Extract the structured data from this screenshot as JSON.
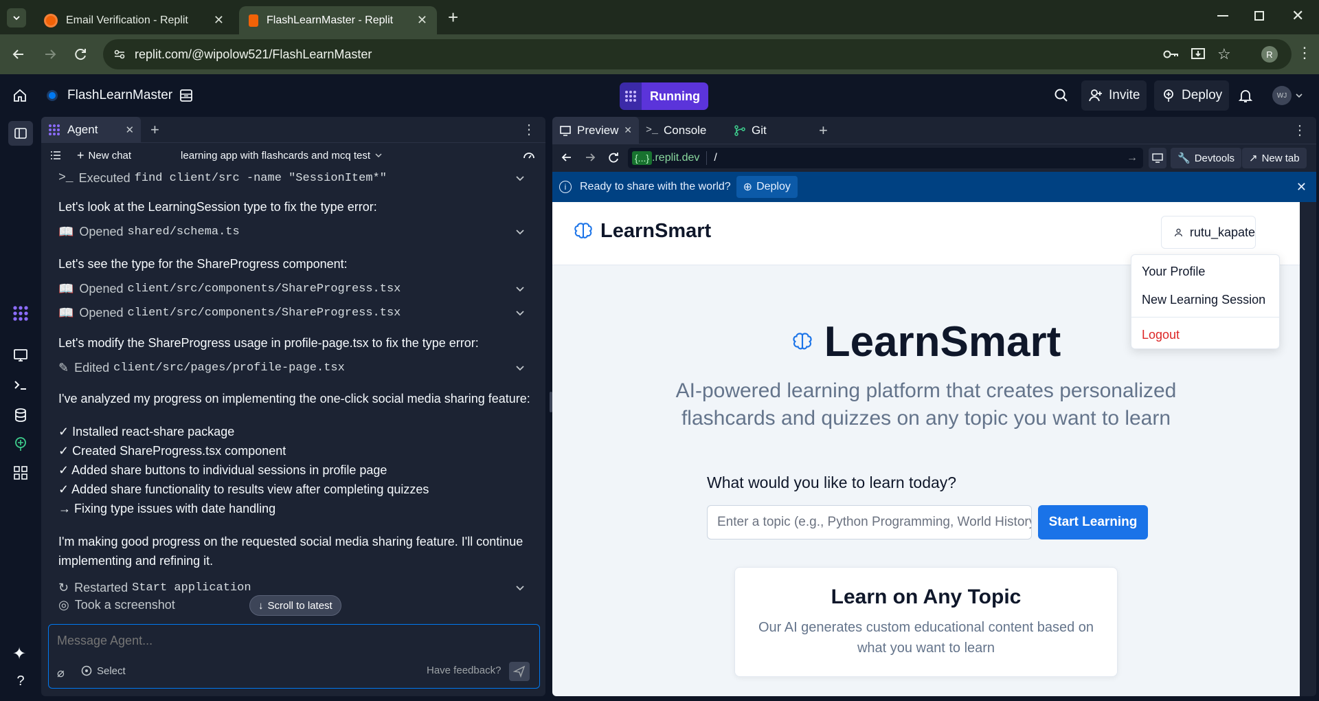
{
  "browser": {
    "tabs": [
      {
        "title": "Email Verification - Replit"
      },
      {
        "title": "FlashLearnMaster - Replit"
      }
    ],
    "url": "replit.com/@wipolow521/FlashLearnMaster",
    "profile_initial": "R"
  },
  "topbar": {
    "project_name": "FlashLearnMaster",
    "run_status": "Running",
    "invite_label": "Invite",
    "deploy_label": "Deploy",
    "avatar_initials": "WJ"
  },
  "agent": {
    "tab_label": "Agent",
    "new_chat_label": "New chat",
    "chat_title": "learning app with flashcards and mcq test",
    "messages": [
      {
        "kind": "action",
        "verb": "Executed",
        "code": "find client/src -name \"SessionItem*\""
      },
      {
        "kind": "text",
        "text": "Let's look at the LearningSession type to fix the type error:"
      },
      {
        "kind": "action",
        "verb": "Opened",
        "code": "shared/schema.ts"
      },
      {
        "kind": "text",
        "text": "Let's see the type for the ShareProgress component:"
      },
      {
        "kind": "action",
        "verb": "Opened",
        "code": "client/src/components/ShareProgress.tsx"
      },
      {
        "kind": "action",
        "verb": "Opened",
        "code": "client/src/components/ShareProgress.tsx"
      },
      {
        "kind": "text",
        "text": "Let's modify the ShareProgress usage in profile-page.tsx to fix the type error:"
      },
      {
        "kind": "action",
        "verb": "Edited",
        "code": "client/src/pages/profile-page.tsx"
      },
      {
        "kind": "text",
        "text": "I've analyzed my progress on implementing the one-click social media sharing feature:"
      }
    ],
    "checklist": [
      "✓ Installed react-share package",
      "✓ Created ShareProgress.tsx component",
      "✓ Added share buttons to individual sessions in profile page",
      "✓ Added share functionality to results view after completing quizzes",
      "→ Fixing type issues with date handling"
    ],
    "progress_line1": "I'm making good progress on the requested social media sharing feature. I'll continue",
    "progress_line2": "implementing and refining it.",
    "restart": {
      "verb": "Restarted",
      "code": "Start application"
    },
    "screenshot": {
      "verb": "Took a screenshot"
    },
    "scroll_latest": "Scroll to latest",
    "input_placeholder": "Message Agent...",
    "select_label": "Select",
    "feedback_label": "Have feedback?"
  },
  "preview": {
    "tabs": [
      {
        "label": "Preview"
      },
      {
        "label": "Console"
      },
      {
        "label": "Git"
      }
    ],
    "url_domain_badge": "{...}",
    "url_domain": ".replit.dev",
    "url_path": "/",
    "devtools_label": "Devtools",
    "newtab_label": "New tab",
    "banner_text": "Ready to share with the world?",
    "banner_deploy": "Deploy"
  },
  "site": {
    "brand": "LearnSmart",
    "user": "rutu_kapate",
    "menu": [
      "Your Profile",
      "New Learning Session",
      "Logout"
    ],
    "hero_title": "LearnSmart",
    "hero_sub": "AI-powered learning platform that creates personalized flashcards and quizzes on any topic you want to learn",
    "ask": "What would you like to learn today?",
    "topic_placeholder": "Enter a topic (e.g., Python Programming, World History)",
    "start_label": "Start Learning",
    "card_title": "Learn on Any Topic",
    "card_text": "Our AI generates custom educational content based on what you want to learn"
  },
  "colors": {
    "accent_running": "#5b34da",
    "banner": "#004182",
    "start_button": "#1a73e8",
    "logout": "#dc2626"
  }
}
